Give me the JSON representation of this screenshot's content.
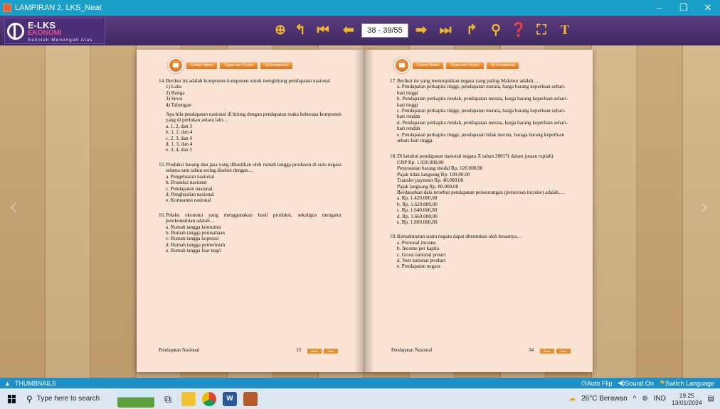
{
  "window": {
    "title": "LAMPIRAN 2. LKS_Neat",
    "minimize": "–",
    "maximize": "❐",
    "close": "✕"
  },
  "logo": {
    "line1": "E-LKS",
    "line2": "EKONOMI",
    "line3": "Sekolah Menengah Atas"
  },
  "toolbar": {
    "page_indicator": "38 - 39/55",
    "icons": [
      "zoom-in",
      "undo",
      "first-page",
      "previous-page",
      "next-page",
      "last-page",
      "redo",
      "search",
      "help",
      "fullscreen",
      "text"
    ]
  },
  "nav": {
    "tab1": "Contoh Materi",
    "tab2": "Tugas dan Proyek",
    "tab3": "Uji Kompetensi"
  },
  "left_page": {
    "questions": [
      {
        "num": "14.",
        "text": "Berikut ini adalah komponen-komponen untuk menghitung pendapatan nasional",
        "items": [
          "1) Laba",
          "2) Bunga",
          "3) Sewa",
          "4) Tabungan"
        ],
        "text2": "Apa bila pendapatan nasional di hitung dengan pendapatan maka beberapa komponen yang di perlukan antara lain…",
        "options": [
          "a. 1, 2, dan 3",
          "b. 1, 2, dan 4",
          "c. 2, 3, dan 4",
          "d. 1, 3, dan 4",
          "e. 3, 4, dan 5"
        ]
      },
      {
        "num": "15.",
        "text": "Produksi barang dan jasa yang dihasilkan oleh rumah tangga produsen di sutu negara selama satu tahun sering disebut dengan…",
        "options": [
          "a. Pengeluaran nasional",
          "b. Prosuksi nasional",
          "c. Pendapatan nasional",
          "d. Penghasilan nasional",
          "e. Komsumsi nasional"
        ]
      },
      {
        "num": "16.",
        "text": "Pelaku ekonomi yang menggunakan hasil produksi, sekaligus mengatur perekonomian adalah…",
        "options": [
          "a. Rumah tangga konsumsi",
          "b. Rumah tangga perusahaan",
          "c. Rumah tangga koperasi",
          "d. Rumah tangga pemerintah",
          "e. Rumah tangga luar negri"
        ]
      }
    ],
    "footer_title": "Pendapatan Nasional",
    "page_number": "33",
    "back": "Back",
    "next": "Next"
  },
  "right_page": {
    "questions": [
      {
        "num": "17.",
        "text": "Berikut ini yang menunjukkan negara yang paling Makmur adalah….",
        "options": [
          "a. Pendapatan perkapita tinggi, pendapatan merata, harga barang keperluan sehari-hari tinggi",
          "b. Pendapatan perkapita rendah, pendapatan merata, harga barang keperluan sehari-hari tinggi",
          "c. Pendapatan perkapita tinggi, pendapatan merata, harga barang keperluan sehari-hari rendah",
          "d. Pendapatan perkapita rendah, pendapatan merata, harga barang keperluan sehari-hari rendah",
          "e. Pendapatan perkapita tinggi, pendapatan tidak merata, haraga barang keperluan sehari-hari tinggi."
        ]
      },
      {
        "num": "18.",
        "text": "Di ketahui pendapatan nasional negara X tahun 20017( dalam jutaan rupiah)",
        "items": [
          "GNP Rp. 1.920.000,00",
          "Penyusutan barang modal Rp. 120.000,00",
          "Pajak tidak langsung Rp. 100.00,00",
          "Transfer payment Rp. 40.000,00",
          "Pajak langsung Rp. 80.000,00"
        ],
        "text2": "Berdasarkan data tersebut pendapatan perseorangan (perseroan income) adalah….",
        "options": [
          "a. Rp. 1.420.000,00",
          "b. Rp. 1.620.000,00",
          "c. Rp. 1.640.000,00",
          "d. Rp. 1.660.000,00",
          "e. Rp. 1.800.000,00"
        ]
      },
      {
        "num": "19.",
        "text": "Kemakmuran suatu negara dapat ditentukan oleh besarnya…",
        "options": [
          "a. Personal income",
          "b. Income per kapita",
          "c. Gross national prouct",
          "d. Nett national product",
          "e. Pendapatan negara"
        ]
      }
    ],
    "footer_title": "Pendapatan Nasional",
    "page_number": "34",
    "back": "Back",
    "next": "Next"
  },
  "bottom_bar": {
    "thumbnails": "THUMBNAILS",
    "auto_flip": "Auto Flip",
    "sound": "Sound On",
    "language": "Switch Language"
  },
  "taskbar": {
    "search_placeholder": "Type here to search",
    "weather": "26°C  Berawan",
    "lang": "IND",
    "time": "19.25",
    "date": "13/01/2024"
  }
}
